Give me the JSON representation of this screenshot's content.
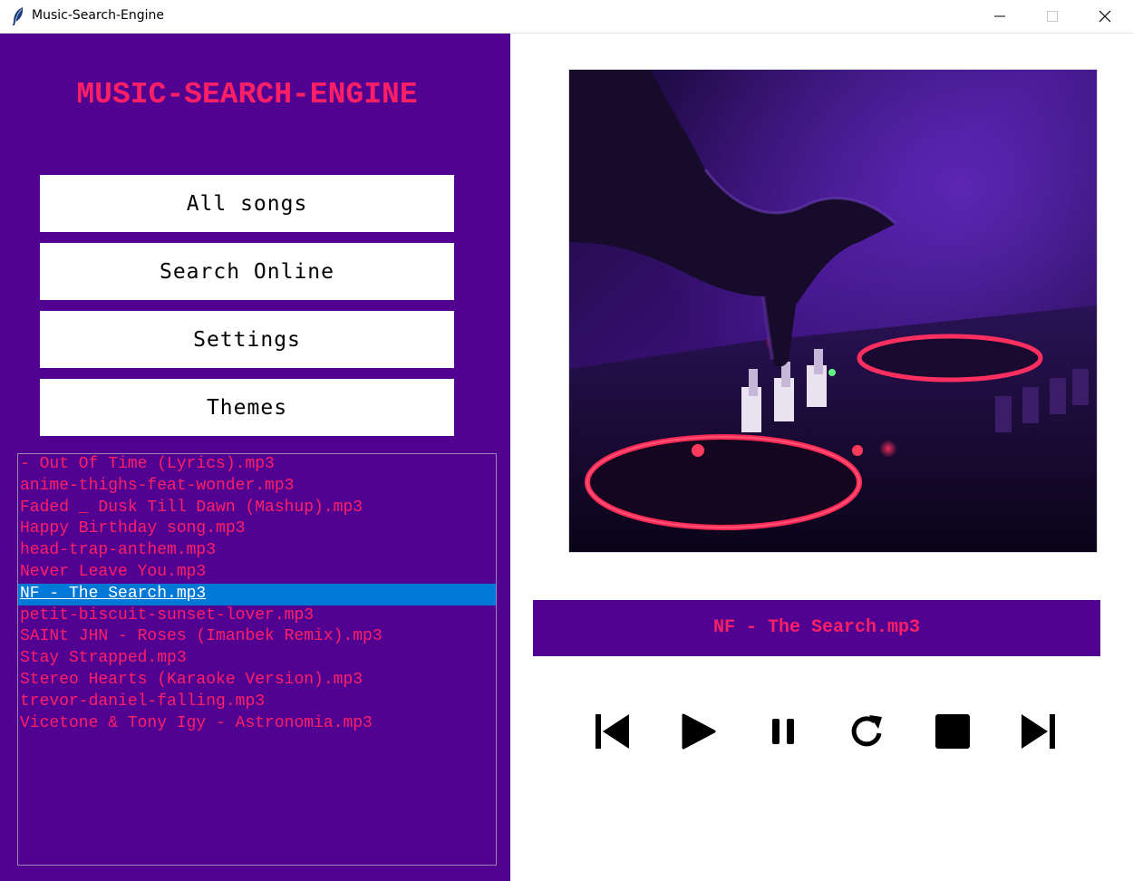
{
  "window": {
    "title": "Music-Search-Engine",
    "icon": "feather-icon"
  },
  "sidebar": {
    "app_title": "MUSIC-SEARCH-ENGINE",
    "buttons": {
      "all_songs": "All songs",
      "search_online": "Search Online",
      "settings": "Settings",
      "themes": "Themes"
    },
    "songs": [
      "- Out Of Time (Lyrics).mp3",
      "anime-thighs-feat-wonder.mp3",
      "Faded _ Dusk Till Dawn (Mashup).mp3",
      "Happy Birthday song.mp3",
      "head-trap-anthem.mp3",
      "Never Leave You.mp3",
      "NF - The Search.mp3",
      "petit-biscuit-sunset-lover.mp3",
      "SAINt JHN - Roses (Imanbek Remix).mp3",
      "Stay Strapped.mp3",
      "Stereo Hearts (Karaoke Version).mp3",
      "trevor-daniel-falling.mp3",
      "Vicetone & Tony Igy - Astronomia.mp3"
    ],
    "selected_index": 6
  },
  "player": {
    "now_playing": "NF - The Search.mp3",
    "controls": [
      "previous-icon",
      "play-icon",
      "pause-icon",
      "repeat-icon",
      "stop-icon",
      "next-icon"
    ]
  },
  "colors": {
    "panel_bg": "#520290",
    "accent_text": "#ff1f67",
    "selection": "#0078d7"
  }
}
